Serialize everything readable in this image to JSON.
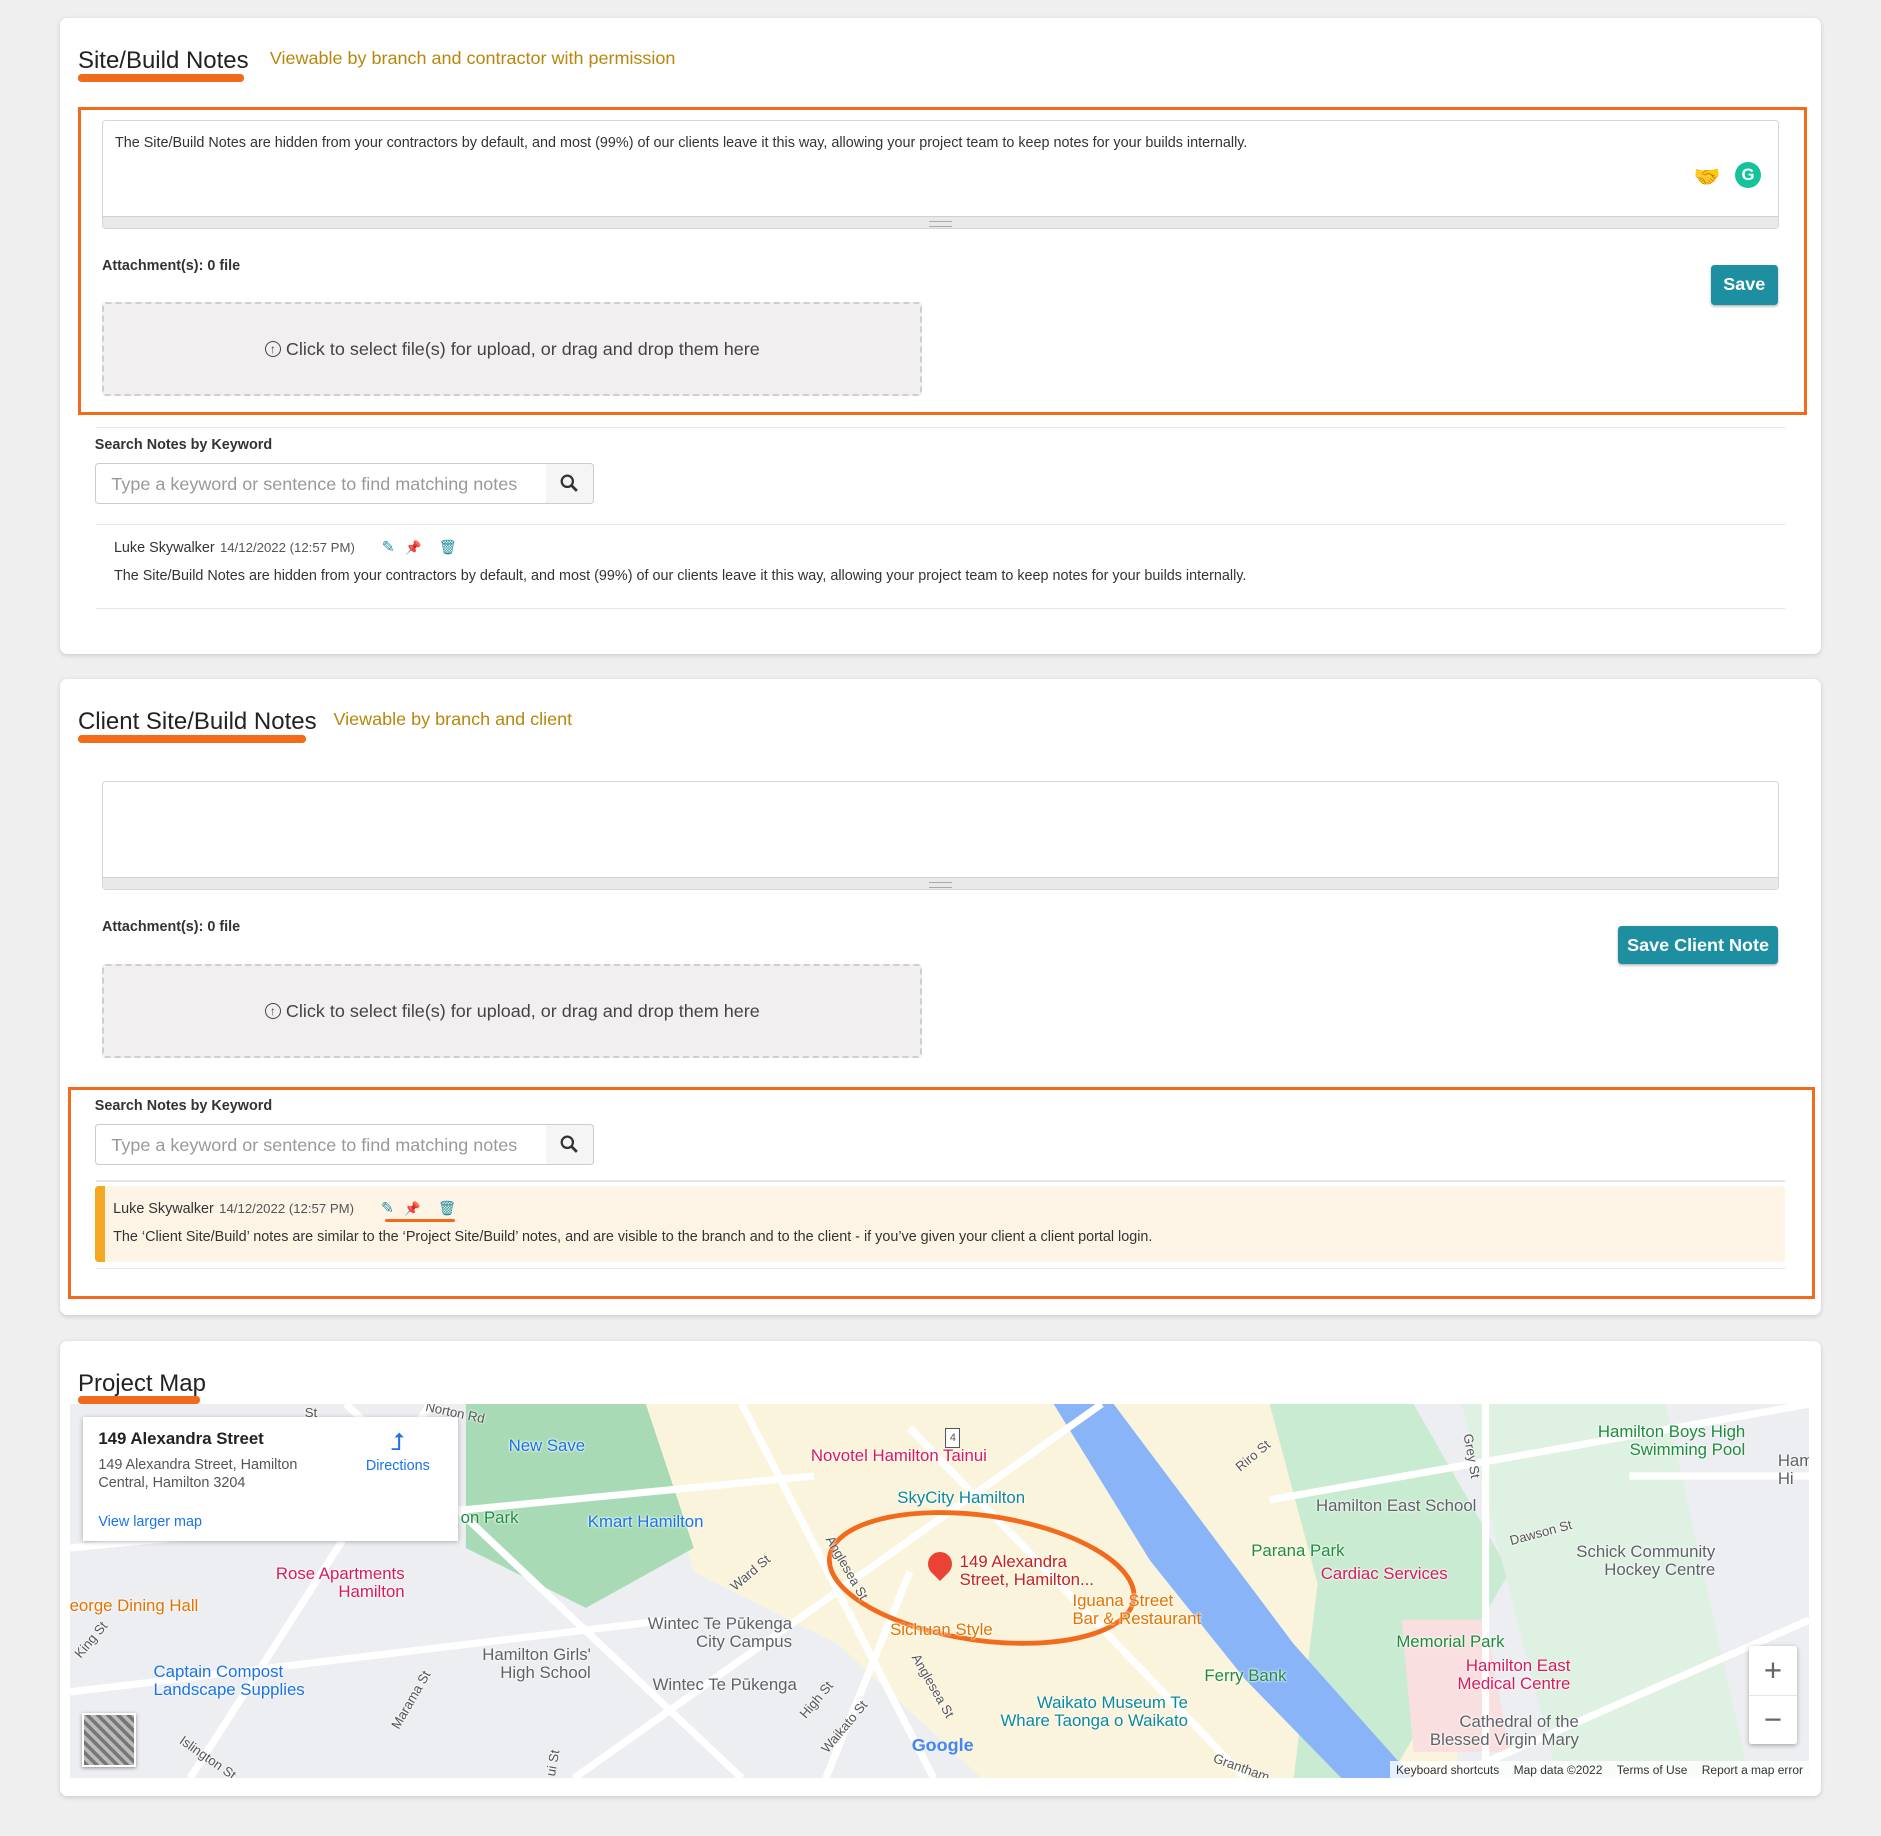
{
  "site_notes": {
    "title": "Site/Build Notes",
    "subtitle": "Viewable by branch and contractor with permission",
    "textarea_value": "The Site/Build Notes are hidden from your contractors by default, and most (99%) of our clients leave it this way, allowing your project team to keep notes for your builds internally.",
    "attachments_label": "Attachment(s): 0 file",
    "save_label": "Save",
    "upload_text": "Click to select file(s) for upload, or drag and drop them here",
    "search_label": "Search Notes by Keyword",
    "search_placeholder": "Type a keyword or sentence to find matching notes",
    "notes": [
      {
        "author": "Luke Skywalker",
        "date": "14/12/2022 (12:57 PM)",
        "text": "The Site/Build Notes are hidden from your contractors by default, and most (99%) of our clients leave it this way, allowing your project team to keep notes for your builds internally."
      }
    ]
  },
  "client_notes": {
    "title": "Client Site/Build Notes",
    "subtitle": "Viewable by branch and client",
    "textarea_value": "",
    "attachments_label": "Attachment(s): 0 file",
    "save_label": "Save Client Note",
    "upload_text": "Click to select file(s) for upload, or drag and drop them here",
    "search_label": "Search Notes by Keyword",
    "search_placeholder": "Type a keyword or sentence to find matching notes",
    "notes": [
      {
        "author": "Luke Skywalker",
        "date": "14/12/2022 (12:57 PM)",
        "text": "The ‘Client Site/Build’ notes are similar to the ‘Project Site/Build’ notes, and are visible to the branch and to the client - if you’ve given your client a client portal login."
      }
    ]
  },
  "project_map": {
    "title": "Project Map",
    "info": {
      "place": "149 Alexandra Street",
      "address_line1": "149 Alexandra Street, Hamilton",
      "address_line2": "Central, Hamilton 3204",
      "directions": "Directions",
      "larger_map": "View larger map"
    },
    "marker_label_1": "149 Alexandra",
    "marker_label_2": "Street, Hamilton...",
    "labels": [
      "New Save",
      "Novotel Hamilton Tainui",
      "SkyCity Hamilton",
      "Kmart Hamilton",
      "on Park",
      "Rose Apartments",
      "Hamilton",
      "eorge Dining Hall",
      "Captain Compost",
      "Landscape Supplies",
      "Hamilton Girls'",
      "High School",
      "Wintec Te Pūkenga",
      "City Campus",
      "Wintec Te Pūkenga",
      "Sichuan Style",
      "Iguana Street",
      "Bar & Restaurant",
      "Waikato Museum Te",
      "Whare Taonga o Waikato",
      "Ferry Bank",
      "Parana Park",
      "Cardiac Services",
      "Hamilton East School",
      "Memorial Park",
      "Hamilton East",
      "Medical Centre",
      "Cathedral of the",
      "Blessed Virgin Mary",
      "Schick Community",
      "Hockey Centre",
      "Hamilton Boys High",
      "Swimming Pool",
      "Hamil",
      "Hi"
    ],
    "roads": [
      "Norton Rd",
      "Ward St",
      "Anglesea St",
      "Anglesea St",
      "High St",
      "Waikato St",
      "King St",
      "Marama St",
      "Islington St",
      "Riro St",
      "Grey St",
      "Dawson St",
      "Grantham",
      "ui St",
      "St",
      "4"
    ],
    "google": "Google",
    "footer": [
      "Keyboard shortcuts",
      "Map data ©2022",
      "Terms of Use",
      "Report a map error"
    ]
  }
}
